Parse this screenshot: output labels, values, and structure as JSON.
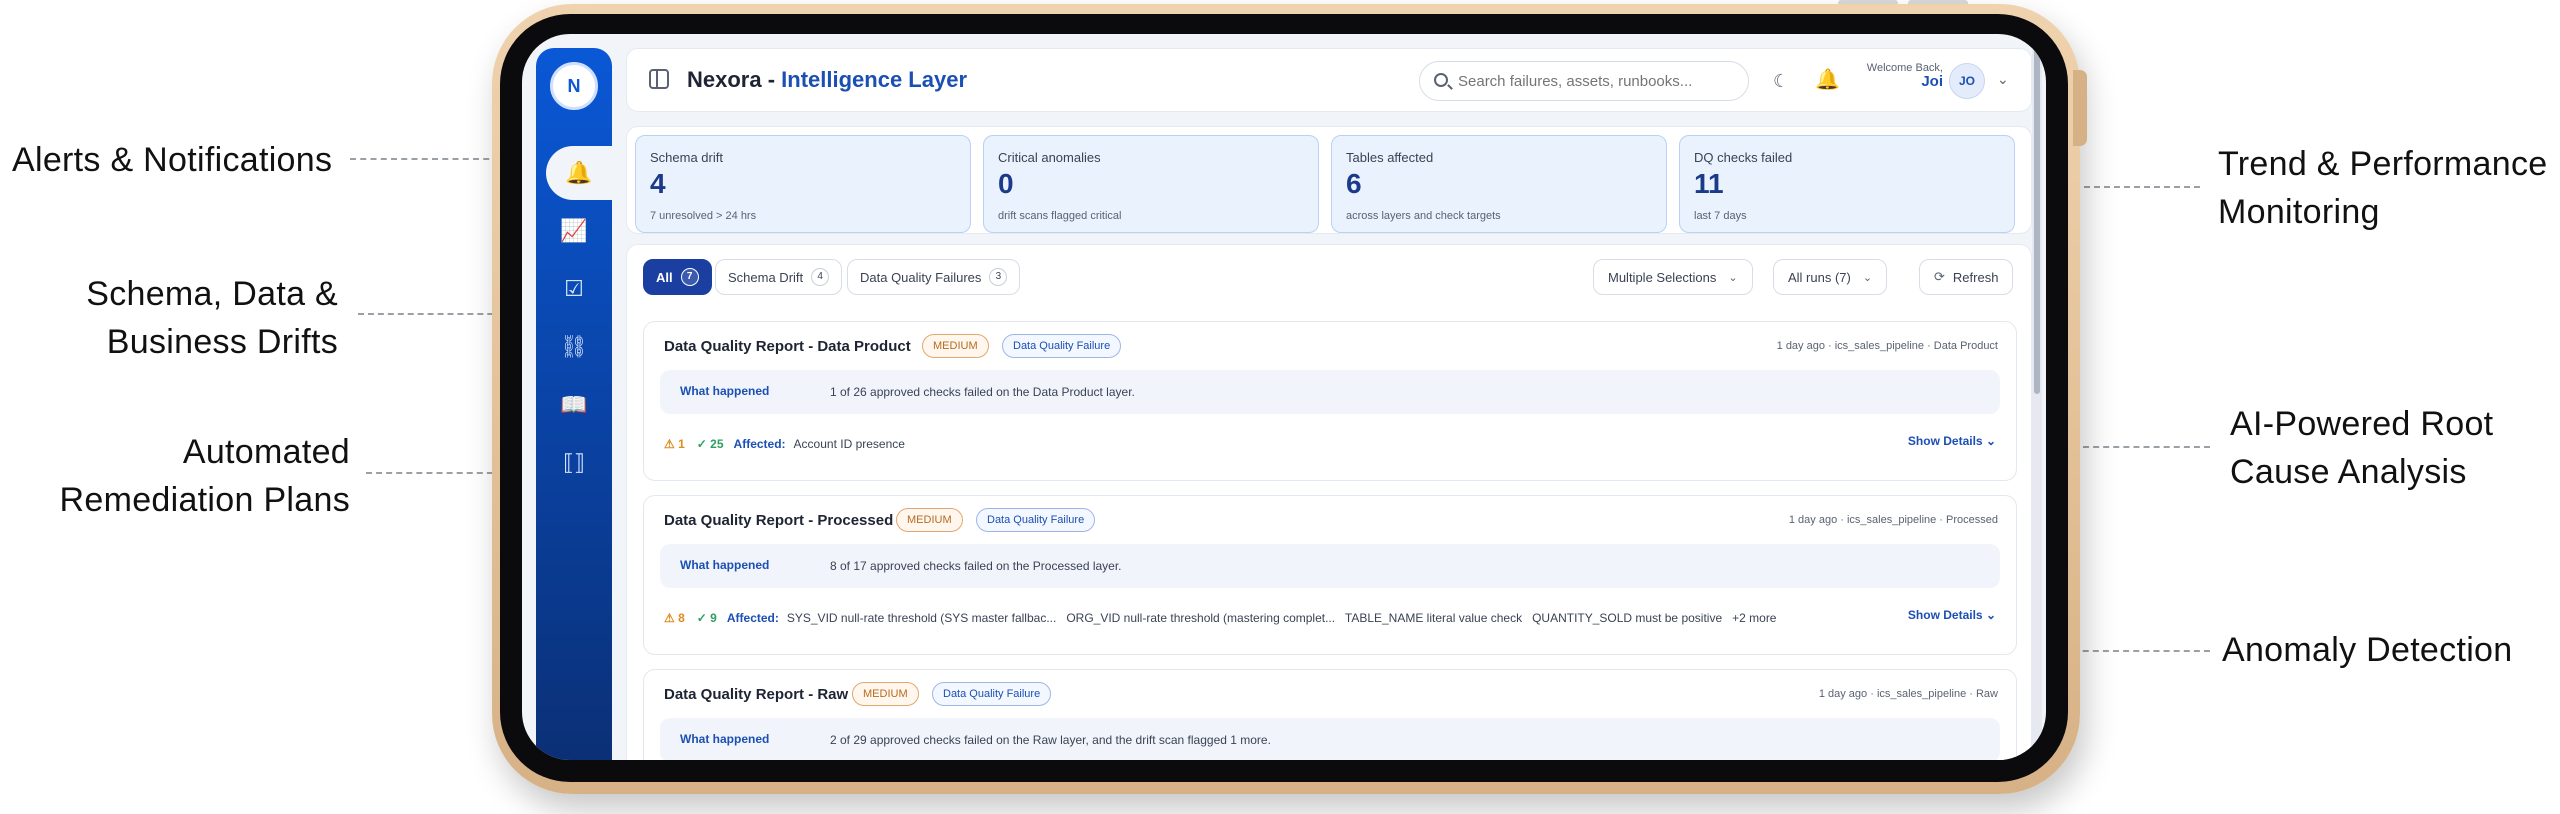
{
  "callouts": {
    "alerts_1": "Alerts & Notifications",
    "schema_1": "Schema, Data &",
    "schema_2": "Business Drifts",
    "remediation_1": "Automated",
    "remediation_2": "Remediation Plans",
    "trend_1": "Trend & Performance",
    "trend_2": "Monitoring",
    "ai_1": "AI-Powered Root",
    "ai_2": "Cause Analysis",
    "anomaly_1": "Anomaly Detection"
  },
  "sidebar": {
    "logo": "N",
    "items": [
      {
        "name": "bell-icon",
        "glyph": "🔔"
      },
      {
        "name": "chart-icon",
        "glyph": "📈"
      },
      {
        "name": "checklist-icon",
        "glyph": "☑"
      },
      {
        "name": "network-icon",
        "glyph": "⛓"
      },
      {
        "name": "book-icon",
        "glyph": "📖"
      },
      {
        "name": "brackets-icon",
        "glyph": "⟦⟧"
      }
    ]
  },
  "header": {
    "brand": "Nexora - ",
    "brand_accent": "Intelligence Layer",
    "search_placeholder": "Search failures, assets, runbooks...",
    "welcome": "Welcome Back,",
    "user": "Joi",
    "avatar": "JO"
  },
  "stats": [
    {
      "label": "Schema drift",
      "value": "4",
      "sub": "7 unresolved > 24 hrs"
    },
    {
      "label": "Critical anomalies",
      "value": "0",
      "sub": "drift scans flagged critical"
    },
    {
      "label": "Tables affected",
      "value": "6",
      "sub": "across layers and check targets"
    },
    {
      "label": "DQ checks failed",
      "value": "11",
      "sub": "last 7 days"
    }
  ],
  "filters": {
    "tabs": [
      {
        "label": "All",
        "count": "7"
      },
      {
        "label": "Schema Drift",
        "count": "4"
      },
      {
        "label": "Data Quality Failures",
        "count": "3"
      }
    ],
    "multi": "Multiple Selections",
    "runs": "All runs (7)",
    "refresh": "Refresh"
  },
  "reports": [
    {
      "title": "Data Quality Report - Data Product",
      "severity": "MEDIUM",
      "type": "Data Quality Failure",
      "meta": "1 day ago · ics_sales_pipeline · Data Product",
      "what_key": "What happened",
      "what": "1 of 26 approved checks failed on the Data Product layer.",
      "warn": "1",
      "ok": "25",
      "affected_label": "Affected:",
      "affected": "Account ID presence",
      "details": "Show Details"
    },
    {
      "title": "Data Quality Report - Processed",
      "severity": "MEDIUM",
      "type": "Data Quality Failure",
      "meta": "1 day ago · ics_sales_pipeline · Processed",
      "what_key": "What happened",
      "what": "8 of 17 approved checks failed on the Processed layer.",
      "warn": "8",
      "ok": "9",
      "affected_label": "Affected:",
      "affected": "SYS_VID null-rate threshold (SYS master fallbac...   ORG_VID null-rate threshold (mastering complet...   TABLE_NAME literal value check   QUANTITY_SOLD must be positive   +2 more",
      "details": "Show Details"
    },
    {
      "title": "Data Quality Report - Raw",
      "severity": "MEDIUM",
      "type": "Data Quality Failure",
      "meta": "1 day ago · ics_sales_pipeline · Raw",
      "what_key": "What happened",
      "what": "2 of 29 approved checks failed on the Raw layer, and the drift scan flagged 1 more."
    }
  ]
}
